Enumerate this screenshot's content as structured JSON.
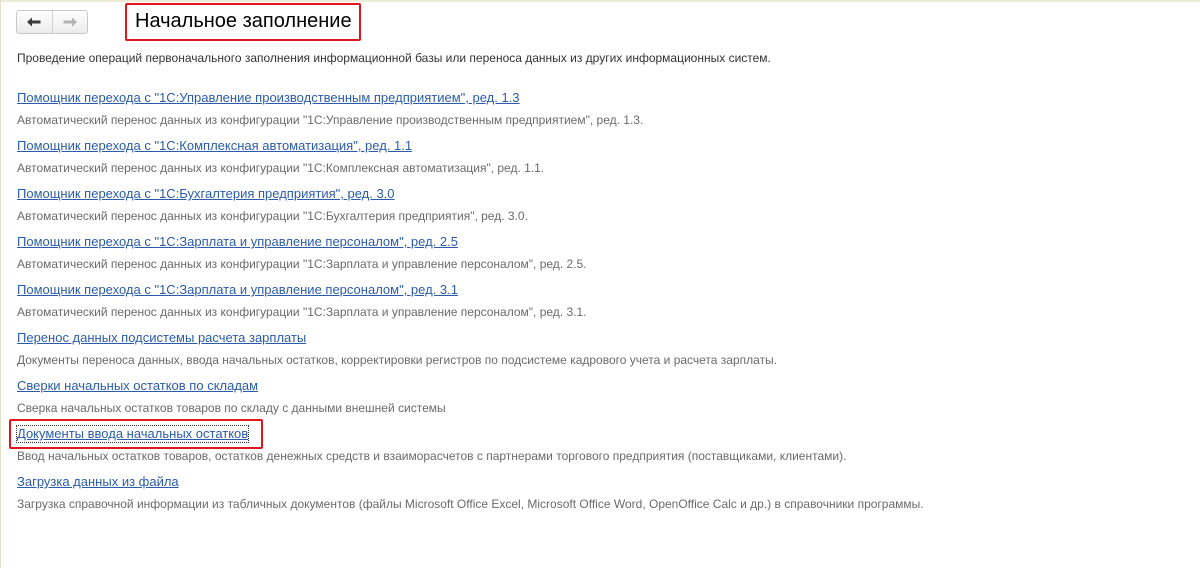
{
  "page": {
    "title": "Начальное заполнение",
    "description": "Проведение операций первоначального заполнения информационной базы или переноса данных из других информационных систем."
  },
  "navigation": {
    "back_icon": "arrow-left-icon",
    "forward_icon": "arrow-right-icon"
  },
  "items": [
    {
      "link": "Помощник перехода с \"1С:Управление производственным предприятием\", ред. 1.3",
      "desc": "Автоматический перенос данных из конфигурации \"1С:Управление производственным предприятием\", ред. 1.3."
    },
    {
      "link": "Помощник перехода с \"1С:Комплексная автоматизация\", ред. 1.1",
      "desc": "Автоматический перенос данных из конфигурации \"1С:Комплексная автоматизация\", ред. 1.1."
    },
    {
      "link": "Помощник перехода с \"1С:Бухгалтерия предприятия\", ред. 3.0",
      "desc": "Автоматический перенос данных из конфигурации \"1С:Бухгалтерия предприятия\", ред. 3.0."
    },
    {
      "link": "Помощник перехода с \"1С:Зарплата и управление персоналом\", ред. 2.5",
      "desc": "Автоматический перенос данных из конфигурации \"1С:Зарплата и управление персоналом\", ред. 2.5."
    },
    {
      "link": "Помощник перехода с \"1С:Зарплата и управление персоналом\", ред. 3.1",
      "desc": "Автоматический перенос данных из конфигурации \"1С:Зарплата и управление персоналом\", ред. 3.1."
    },
    {
      "link": "Перенос данных подсистемы расчета зарплаты",
      "desc": "Документы переноса данных, ввода начальных остатков, корректировки регистров по подсистеме кадрового учета и расчета зарплаты."
    },
    {
      "link": "Сверки начальных остатков по складам",
      "desc": "Сверка начальных остатков товаров по складу с данными внешней системы"
    },
    {
      "link": "Документы ввода начальных остатков",
      "desc": "Ввод начальных остатков товаров, остатков денежных средств и взаиморасчетов с партнерами торгового предприятия (поставщиками, клиентами)."
    },
    {
      "link": "Загрузка данных из файла",
      "desc": "Загрузка справочной информации из табличных документов (файлы Microsoft Office Excel, Microsoft Office Word, OpenOffice Calc и др.) в справочники программы."
    }
  ],
  "colors": {
    "link": "#2a5caa",
    "description": "#6a6a6a",
    "highlight": "#e1151c"
  }
}
